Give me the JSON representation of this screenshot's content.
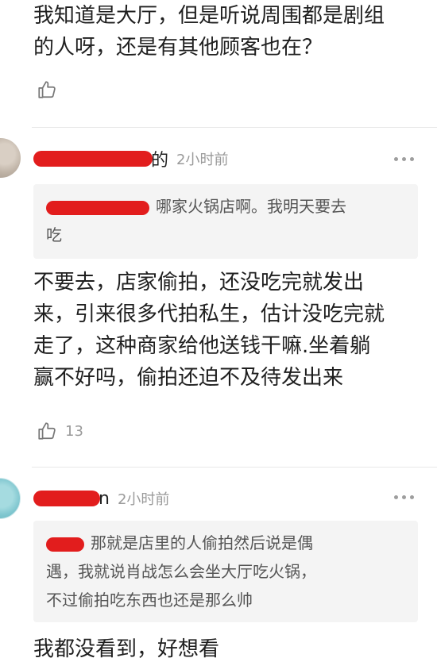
{
  "top_comment": {
    "line1": "我知道是大厅，但是听说周围都是剧组",
    "line2": "的人呀，还是有其他顾客也在？"
  },
  "comment_1": {
    "name_tail": "的",
    "time": "2小时前",
    "quote_text_line1": "哪家火锅店啊。我明天要去",
    "quote_text_line2": "吃",
    "body_line1": "不要去，店家偷拍，还没吃完就发出",
    "body_line2": "来，引来很多代拍私生，估计没吃完就",
    "body_line3": "走了，这种商家给他送钱干嘛.坐着躺",
    "body_line4": "赢不好吗，偷拍还迫不及待发出来",
    "likes": "13"
  },
  "comment_2": {
    "name_tail": "n",
    "time": "2小时前",
    "quote_text_line1": "那就是店里的人偷拍然后说是偶",
    "quote_text_line2": "遇，我就说肖战怎么会坐大厅吃火锅，",
    "quote_text_line3": "不过偷拍吃东西也还是那么帅",
    "body_line1": "我都没看到，好想看"
  },
  "colors": {
    "redaction": "#e21d1d",
    "divider": "#e8e8e8",
    "quote_bg": "#f4f4f4",
    "muted_text": "#9a9a9a"
  }
}
